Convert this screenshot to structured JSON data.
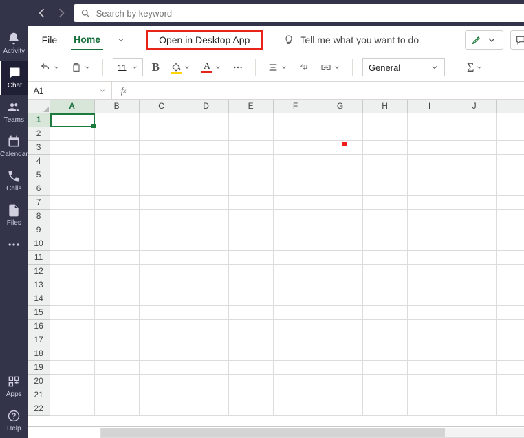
{
  "search": {
    "placeholder": "Search by keyword"
  },
  "rail": {
    "items": [
      {
        "id": "activity",
        "label": "Activity"
      },
      {
        "id": "chat",
        "label": "Chat"
      },
      {
        "id": "teams",
        "label": "Teams"
      },
      {
        "id": "calendar",
        "label": "Calendar"
      },
      {
        "id": "calls",
        "label": "Calls"
      },
      {
        "id": "files",
        "label": "Files"
      }
    ],
    "bottom": [
      {
        "id": "apps",
        "label": "Apps"
      },
      {
        "id": "help",
        "label": "Help"
      }
    ]
  },
  "ribbon": {
    "tabs": {
      "file": "File",
      "home": "Home"
    },
    "open_desktop": "Open in Desktop App",
    "tell_me": "Tell me what you want to do"
  },
  "toolbar": {
    "font_size": "11",
    "number_format": "General"
  },
  "namebox": {
    "ref": "A1"
  },
  "grid": {
    "columns": [
      "A",
      "B",
      "C",
      "D",
      "E",
      "F",
      "G",
      "H",
      "I",
      "J"
    ],
    "row_count": 22,
    "active_col": "A",
    "active_row": 1
  },
  "colors": {
    "fill_underline": "#ffd400",
    "font_underline": "#e8231a"
  }
}
